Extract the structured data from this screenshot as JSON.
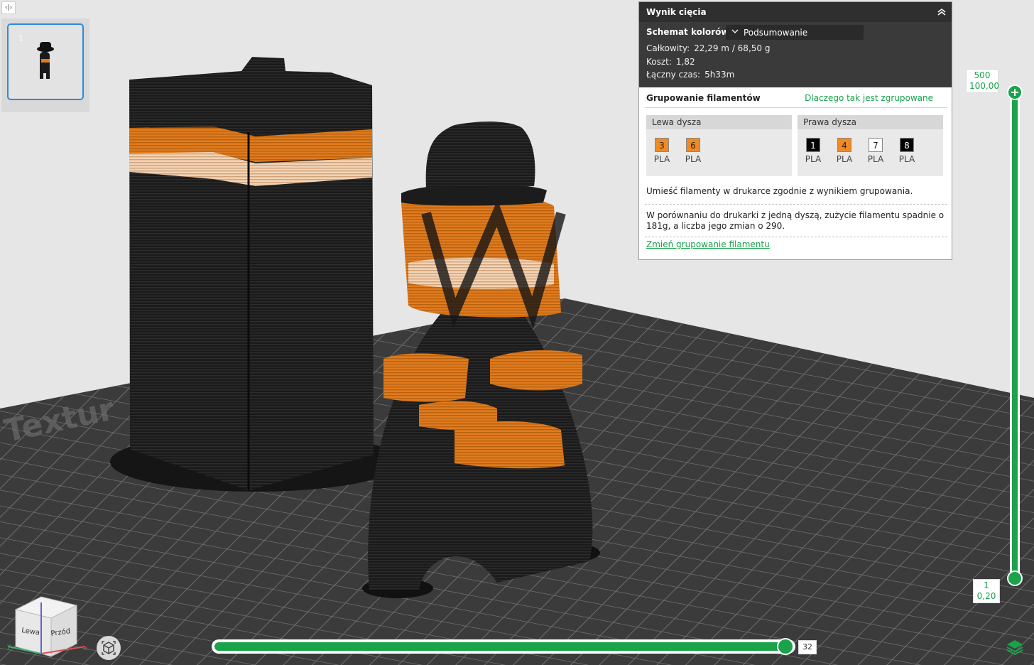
{
  "toolbar": {
    "toggle_glyph": "‹|›"
  },
  "plate": {
    "number": "1"
  },
  "bed": {
    "watermark": "Textur"
  },
  "result_panel": {
    "title": "Wynik cięcia",
    "color_scheme_label": "Schemat kolorów",
    "color_scheme_value": "Podsumowanie",
    "stats": [
      {
        "label": "Całkowity:",
        "value": "22,29 m / 68,50 g"
      },
      {
        "label": "Koszt:",
        "value": "1,82"
      },
      {
        "label": "Łączny czas:",
        "value": "5h33m"
      }
    ],
    "grouping_title": "Grupowanie filamentów",
    "grouping_why": "Dlaczego tak jest zgrupowane",
    "left_nozzle": {
      "label": "Lewa dysza",
      "filaments": [
        {
          "id": "3",
          "material": "PLA",
          "color": "#f08a24",
          "text_color": "#222222"
        },
        {
          "id": "6",
          "material": "PLA",
          "color": "#f08a24",
          "text_color": "#222222"
        }
      ]
    },
    "right_nozzle": {
      "label": "Prawa dysza",
      "filaments": [
        {
          "id": "1",
          "material": "PLA",
          "color": "#000000",
          "text_color": "#ffffff"
        },
        {
          "id": "4",
          "material": "PLA",
          "color": "#f08a24",
          "text_color": "#222222"
        },
        {
          "id": "7",
          "material": "PLA",
          "color": "#ffffff",
          "text_color": "#222222"
        },
        {
          "id": "8",
          "material": "PLA",
          "color": "#000000",
          "text_color": "#ffffff"
        }
      ]
    },
    "note_place": "Umieść filamenty w drukarce zgodnie z wynikiem grupowania.",
    "note_compare": "W porównaniu do drukarki z jedną dyszą, zużycie filamentu spadnie o 181g, a liczba jego zmian o 290.",
    "change_link": "Zmień grupowanie filamentu"
  },
  "layer_slider": {
    "top_layer": "500",
    "top_height": "100,00",
    "bottom_layer": "1",
    "bottom_height": "0,20",
    "accent": "#1aa34a"
  },
  "move_slider": {
    "value": "32"
  },
  "view_cube": {
    "left_label": "Lewa",
    "front_label": "Przód"
  },
  "colors": {
    "orange": "#f08a24",
    "black": "#151515",
    "bed": "#3b3b3b"
  }
}
